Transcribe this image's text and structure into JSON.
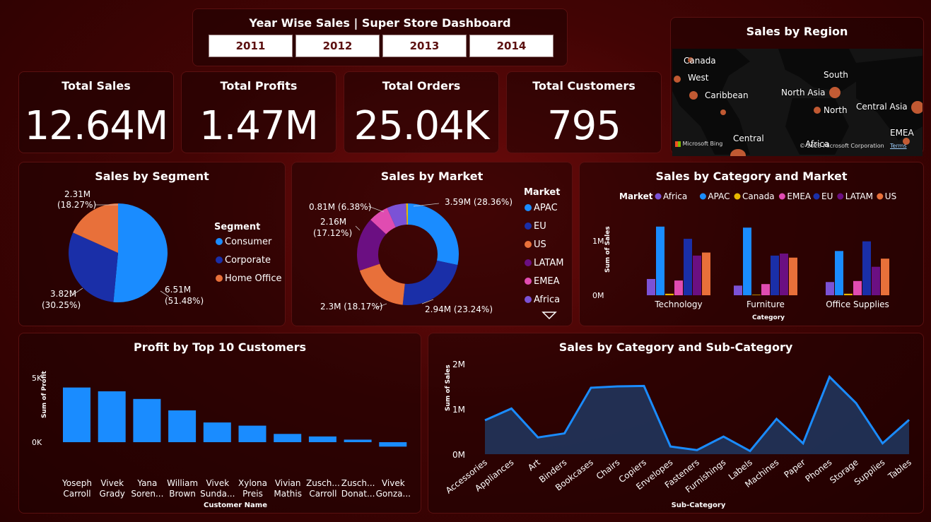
{
  "header": {
    "title": "Year Wise Sales | Super Store Dashboard",
    "years": [
      "2011",
      "2012",
      "2013",
      "2014"
    ]
  },
  "kpis": [
    {
      "label": "Total Sales",
      "value": "12.64M"
    },
    {
      "label": "Total Profits",
      "value": "1.47M"
    },
    {
      "label": "Total Orders",
      "value": "25.04K"
    },
    {
      "label": "Total Customers",
      "value": "795"
    }
  ],
  "map": {
    "title": "Sales by Region",
    "labels": [
      "Canada",
      "West",
      "Caribbean",
      "South",
      "North Asia",
      "North",
      "Central Asia",
      "EMEA",
      "Central",
      "Africa"
    ],
    "bing": "Microsoft Bing",
    "copyright": "© 2023 Microsoft Corporation",
    "terms": "Terms"
  },
  "colors": {
    "accent": "#1a8cff",
    "APAC": "#1a8cff",
    "EU": "#1a2fa8",
    "US": "#e8703a",
    "LATAM": "#6b0f82",
    "EMEA": "#e04cb1",
    "Africa": "#7b52d6",
    "Canada": "#e8b800"
  },
  "segment": {
    "title": "Sales by Segment",
    "legend_title": "Segment",
    "legend": [
      "Consumer",
      "Corporate",
      "Home Office"
    ],
    "labels": {
      "consumer": [
        "6.51M",
        "(51.48%)"
      ],
      "corporate": [
        "3.82M",
        "(30.25%)"
      ],
      "home": [
        "2.31M",
        "(18.27%)"
      ]
    }
  },
  "market": {
    "title": "Sales by Market",
    "legend_title": "Market",
    "legend": [
      "APAC",
      "EU",
      "US",
      "LATAM",
      "EMEA",
      "Africa"
    ],
    "labels": {
      "apac": "3.59M (28.36%)",
      "eu": "2.94M (23.24%)",
      "us": "2.3M (18.17%)",
      "latam": [
        "2.16M",
        "(17.12%)"
      ],
      "emea": "0.81M (6.38%)"
    }
  },
  "catmarket": {
    "title": "Sales by Category and Market",
    "legend_title": "Market",
    "legend": [
      "Africa",
      "APAC",
      "Canada",
      "EMEA",
      "EU",
      "LATAM",
      "US"
    ],
    "ylabel": "Sum of Sales",
    "xlabel": "Category",
    "yticks": [
      "0M",
      "1M"
    ]
  },
  "customers": {
    "title": "Profit by Top 10 Customers",
    "ylabel": "Sum of Profit",
    "xlabel": "Customer Name",
    "yticks": [
      "0K",
      "5K"
    ],
    "names": [
      [
        "Yoseph",
        "Carroll"
      ],
      [
        "Vivek",
        "Grady"
      ],
      [
        "Yana",
        "Soren..."
      ],
      [
        "William",
        "Brown"
      ],
      [
        "Vivek",
        "Sunda..."
      ],
      [
        "Xylona",
        "Preis"
      ],
      [
        "Vivian",
        "Mathis"
      ],
      [
        "Zusch...",
        "Carroll"
      ],
      [
        "Zusch...",
        "Donat..."
      ],
      [
        "Vivek",
        "Gonza..."
      ]
    ]
  },
  "subcat": {
    "title": "Sales by Category and Sub-Category",
    "ylabel": "Sum of Sales",
    "xlabel": "Sub-Category",
    "yticks": [
      "0M",
      "1M",
      "2M"
    ]
  },
  "chart_data": [
    {
      "type": "pie",
      "title": "Sales by Segment",
      "categories": [
        "Consumer",
        "Corporate",
        "Home Office"
      ],
      "values": [
        6.51,
        3.82,
        2.31
      ],
      "percents": [
        51.48,
        30.25,
        18.27
      ],
      "legend": "right"
    },
    {
      "type": "pie",
      "title": "Sales by Market",
      "categories": [
        "APAC",
        "EU",
        "US",
        "LATAM",
        "EMEA",
        "Africa",
        "Canada"
      ],
      "values": [
        3.59,
        2.94,
        2.3,
        2.16,
        0.81,
        0.78,
        0.07
      ],
      "percents": [
        28.36,
        23.24,
        18.17,
        17.12,
        6.38,
        6.17,
        0.56
      ],
      "legend": "right"
    },
    {
      "type": "bar",
      "title": "Sales by Category and Market",
      "categories": [
        "Technology",
        "Furniture",
        "Office Supplies"
      ],
      "series": [
        {
          "name": "Africa",
          "values": [
            0.32,
            0.19,
            0.26
          ]
        },
        {
          "name": "APAC",
          "values": [
            1.35,
            1.33,
            0.87
          ]
        },
        {
          "name": "Canada",
          "values": [
            0.03,
            0.01,
            0.03
          ]
        },
        {
          "name": "EMEA",
          "values": [
            0.29,
            0.22,
            0.28
          ]
        },
        {
          "name": "EU",
          "values": [
            1.11,
            0.78,
            1.06
          ]
        },
        {
          "name": "LATAM",
          "values": [
            0.78,
            0.82,
            0.56
          ]
        },
        {
          "name": "US",
          "values": [
            0.84,
            0.74,
            0.72
          ]
        }
      ],
      "ylim": [
        0,
        1.5
      ],
      "legend": "top"
    },
    {
      "type": "bar",
      "title": "Profit by Top 10 Customers",
      "categories": [
        "Yoseph Carroll",
        "Vivek Grady",
        "Yana Soren...",
        "William Brown",
        "Vivek Sunda...",
        "Xylona Preis",
        "Vivian Mathis",
        "Zusch... Carroll",
        "Zusch... Donat...",
        "Vivek Gonza..."
      ],
      "values": [
        4.3,
        4.0,
        3.4,
        2.5,
        1.55,
        1.3,
        0.65,
        0.45,
        0.2,
        -0.35
      ],
      "ylim": [
        -0.5,
        5.5
      ]
    },
    {
      "type": "area",
      "title": "Sales by Category and Sub-Category",
      "categories": [
        "Accessories",
        "Appliances",
        "Art",
        "Binders",
        "Bookcases",
        "Chairs",
        "Copiers",
        "Envelopes",
        "Fasteners",
        "Furnishings",
        "Labels",
        "Machines",
        "Paper",
        "Phones",
        "Storage",
        "Supplies",
        "Tables"
      ],
      "values": [
        0.75,
        1.01,
        0.37,
        0.46,
        1.47,
        1.5,
        1.51,
        0.17,
        0.09,
        0.39,
        0.07,
        0.78,
        0.24,
        1.71,
        1.13,
        0.24,
        0.76
      ],
      "ylim": [
        0,
        2
      ]
    }
  ]
}
